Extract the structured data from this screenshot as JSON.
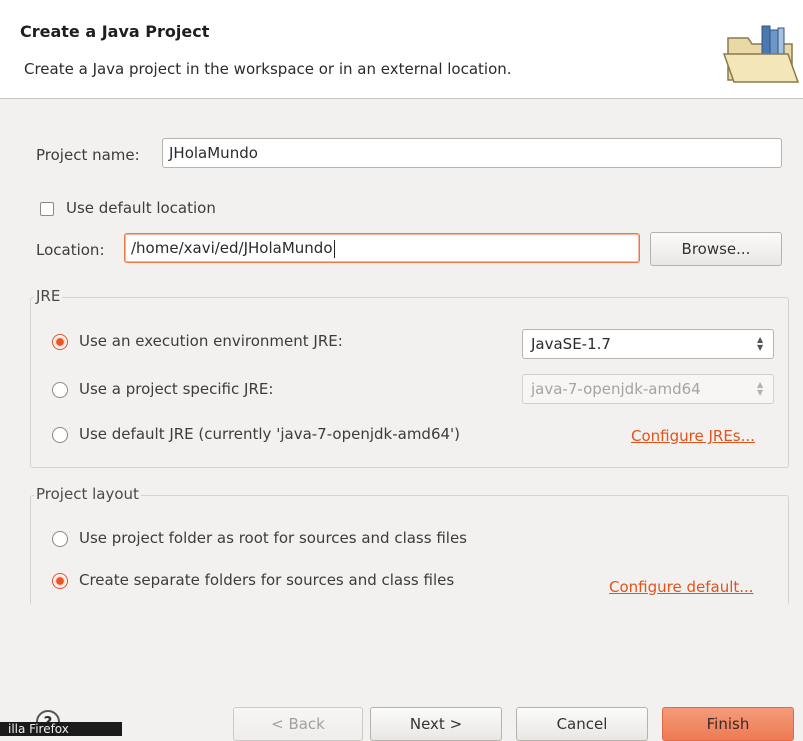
{
  "header": {
    "title": "Create a Java Project",
    "description": "Create a Java project in the workspace or in an external location."
  },
  "project_name": {
    "label": "Project name:",
    "value": "JHolaMundo"
  },
  "use_default_location": {
    "label": "Use default location",
    "checked": false
  },
  "location": {
    "label": "Location:",
    "value": "/home/xavi/ed/JHolaMundo",
    "browse_label": "Browse..."
  },
  "jre": {
    "title": "JRE",
    "options": [
      {
        "label": "Use an execution environment JRE:",
        "selected": true
      },
      {
        "label": "Use a project specific JRE:",
        "selected": false
      },
      {
        "label": "Use default JRE (currently 'java-7-openjdk-amd64')",
        "selected": false
      }
    ],
    "execution_env_value": "JavaSE-1.7",
    "project_jre_value": "java-7-openjdk-amd64",
    "configure_link": "Configure JREs..."
  },
  "layout": {
    "title": "Project layout",
    "options": [
      {
        "label": "Use project folder as root for sources and class files",
        "selected": false
      },
      {
        "label": "Create separate folders for sources and class files",
        "selected": true
      }
    ],
    "configure_link": "Configure default..."
  },
  "buttons": {
    "back": "< Back",
    "next": "Next >",
    "cancel": "Cancel",
    "finish": "Finish",
    "help": "?"
  },
  "taskbar": {
    "text": "illa Firefox"
  },
  "colors": {
    "accent": "#f07746",
    "link": "#e2531c",
    "finish": "#ed7b54"
  }
}
